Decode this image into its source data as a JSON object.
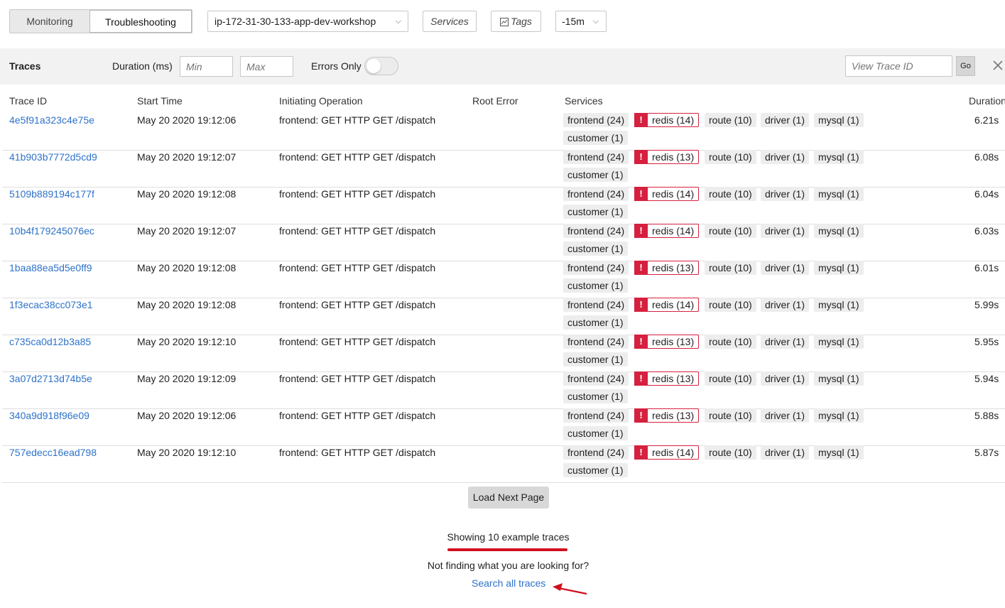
{
  "topbar": {
    "tab_monitoring": "Monitoring",
    "tab_troubleshooting": "Troubleshooting",
    "environment": "ip-172-31-30-133-app-dev-workshop",
    "services_label": "Services",
    "tags_label": "Tags",
    "time_range": "-15m"
  },
  "filter": {
    "title": "Traces",
    "duration_label": "Duration (ms)",
    "min_placeholder": "Min",
    "max_placeholder": "Max",
    "errors_only_label": "Errors Only",
    "errors_only_on": false,
    "trace_id_placeholder": "View Trace ID",
    "go_label": "Go"
  },
  "table": {
    "headers": {
      "trace_id": "Trace ID",
      "start_time": "Start Time",
      "operation": "Initiating Operation",
      "root_error": "Root Error",
      "services": "Services",
      "duration": "Duration"
    },
    "rows": [
      {
        "id": "4e5f91a323c4e75e",
        "start": "May 20 2020 19:12:06",
        "op": "frontend: GET HTTP GET /dispatch",
        "redis": "redis (14)",
        "duration": "6.21s"
      },
      {
        "id": "41b903b7772d5cd9",
        "start": "May 20 2020 19:12:07",
        "op": "frontend: GET HTTP GET /dispatch",
        "redis": "redis (13)",
        "duration": "6.08s"
      },
      {
        "id": "5109b889194c177f",
        "start": "May 20 2020 19:12:08",
        "op": "frontend: GET HTTP GET /dispatch",
        "redis": "redis (14)",
        "duration": "6.04s"
      },
      {
        "id": "10b4f179245076ec",
        "start": "May 20 2020 19:12:07",
        "op": "frontend: GET HTTP GET /dispatch",
        "redis": "redis (14)",
        "duration": "6.03s"
      },
      {
        "id": "1baa88ea5d5e0ff9",
        "start": "May 20 2020 19:12:08",
        "op": "frontend: GET HTTP GET /dispatch",
        "redis": "redis (13)",
        "duration": "6.01s"
      },
      {
        "id": "1f3ecac38cc073e1",
        "start": "May 20 2020 19:12:08",
        "op": "frontend: GET HTTP GET /dispatch",
        "redis": "redis (14)",
        "duration": "5.99s"
      },
      {
        "id": "c735ca0d12b3a85",
        "start": "May 20 2020 19:12:10",
        "op": "frontend: GET HTTP GET /dispatch",
        "redis": "redis (13)",
        "duration": "5.95s"
      },
      {
        "id": "3a07d2713d74b5e",
        "start": "May 20 2020 19:12:09",
        "op": "frontend: GET HTTP GET /dispatch",
        "redis": "redis (13)",
        "duration": "5.94s"
      },
      {
        "id": "340a9d918f96e09",
        "start": "May 20 2020 19:12:06",
        "op": "frontend: GET HTTP GET /dispatch",
        "redis": "redis (13)",
        "duration": "5.88s"
      },
      {
        "id": "757edecc16ead798",
        "start": "May 20 2020 19:12:10",
        "op": "frontend: GET HTTP GET /dispatch",
        "redis": "redis (14)",
        "duration": "5.87s"
      }
    ],
    "services_common": {
      "frontend": "frontend (24)",
      "route": "route (10)",
      "driver": "driver (1)",
      "mysql": "mysql (1)",
      "customer": "customer (1)"
    },
    "error_mark": "!"
  },
  "footer": {
    "load_next": "Load Next Page",
    "showing": "Showing 10 example traces",
    "not_finding": "Not finding what you are looking for?",
    "search_all": "Search all traces"
  },
  "colors": {
    "link": "#2d72c9",
    "error": "#d6203f",
    "annotation": "#d0101f"
  }
}
